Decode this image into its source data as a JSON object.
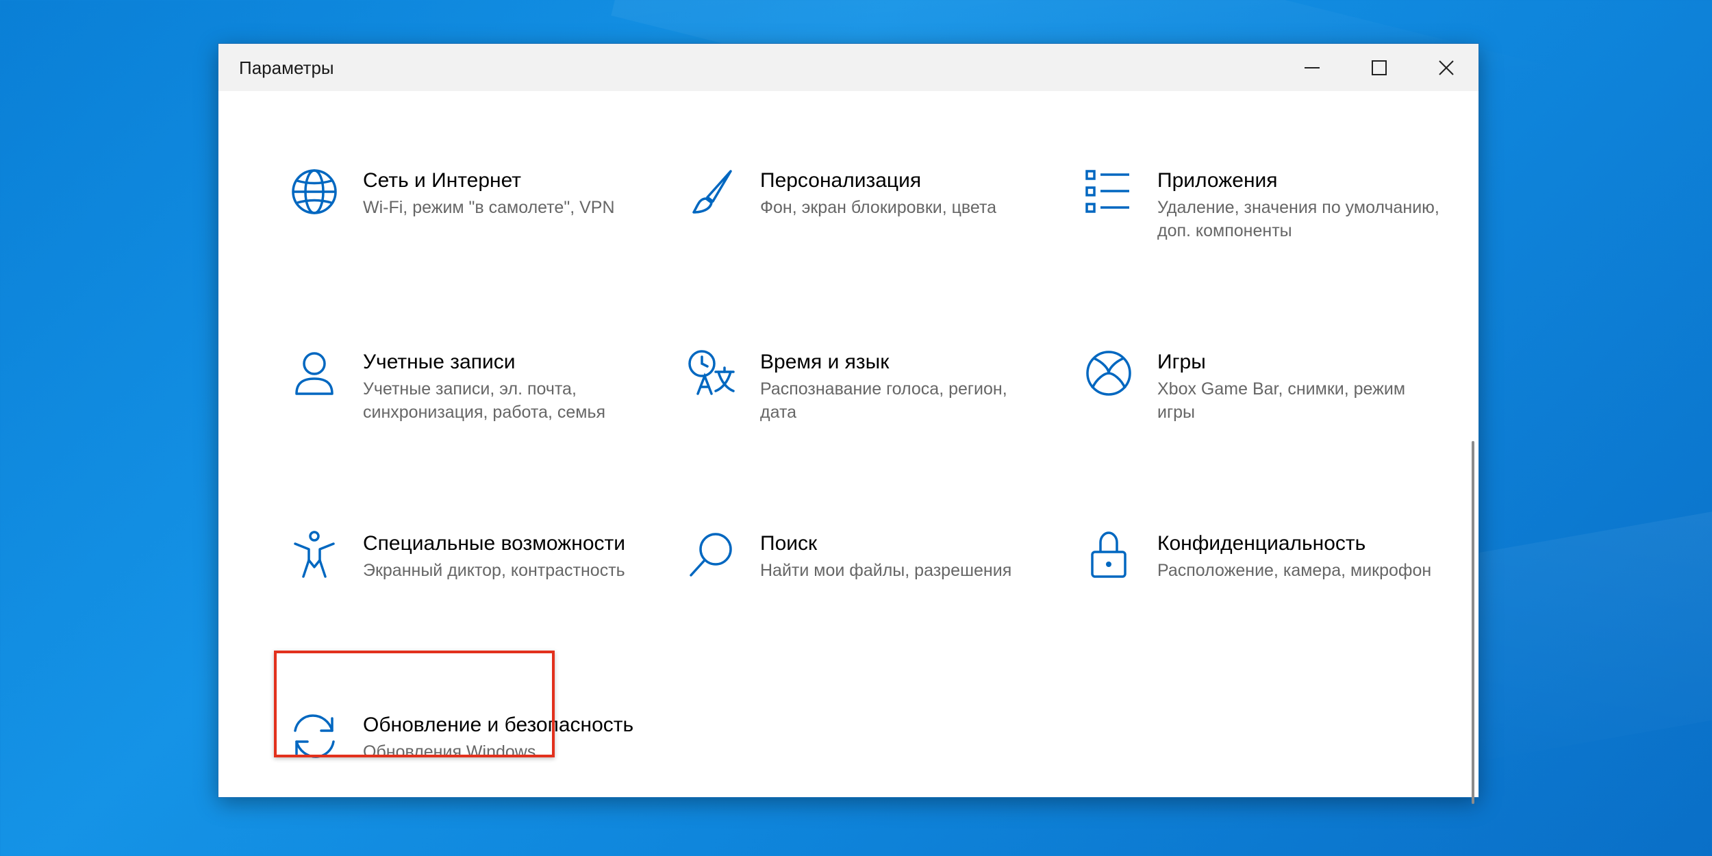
{
  "window": {
    "title": "Параметры"
  },
  "colors": {
    "accent": "#0067c0",
    "highlight": "#e2311d"
  },
  "tiles": [
    {
      "icon": "globe-icon",
      "title": "Сеть и Интернет",
      "desc": "Wi-Fi, режим \"в самолете\", VPN"
    },
    {
      "icon": "brush-icon",
      "title": "Персонализация",
      "desc": "Фон, экран блокировки, цвета"
    },
    {
      "icon": "apps-list-icon",
      "title": "Приложения",
      "desc": "Удаление, значения по умолчанию, доп. компоненты"
    },
    {
      "icon": "user-icon",
      "title": "Учетные записи",
      "desc": "Учетные записи, эл. почта, синхронизация, работа, семья"
    },
    {
      "icon": "time-language-icon",
      "title": "Время и язык",
      "desc": "Распознавание голоса, регион, дата"
    },
    {
      "icon": "xbox-icon",
      "title": "Игры",
      "desc": "Xbox Game Bar, снимки, режим игры"
    },
    {
      "icon": "accessibility-icon",
      "title": "Специальные возможности",
      "desc": "Экранный диктор, контрастность"
    },
    {
      "icon": "search-icon",
      "title": "Поиск",
      "desc": "Найти мои файлы, разрешения"
    },
    {
      "icon": "lock-icon",
      "title": "Конфиденциальность",
      "desc": "Расположение, камера, микрофон"
    },
    {
      "icon": "update-sync-icon",
      "title": "Обновление и безопасность",
      "desc": "Обновления Windows"
    }
  ]
}
